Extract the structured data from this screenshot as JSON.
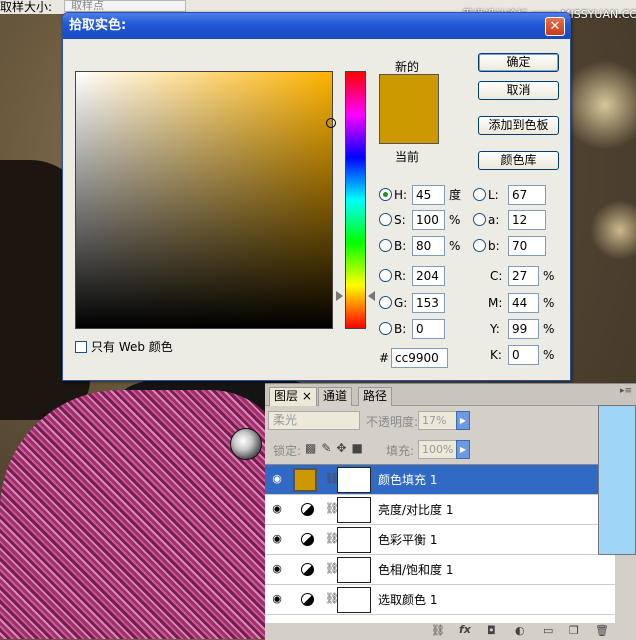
{
  "top": {
    "sample_label": "取样大小:",
    "sample_value": "取样点",
    "site": "思缘设计论坛 www.MISSYUAN.COM"
  },
  "dialog": {
    "title": "拾取实色:",
    "close": "✕",
    "new_label": "新的",
    "current_label": "当前",
    "color_hex": "#cc9900",
    "buttons": {
      "ok": "确定",
      "cancel": "取消",
      "add_swatch": "添加到色板",
      "library": "颜色库"
    },
    "web_only": "只有 Web 颜色",
    "hsb": {
      "h": "45",
      "s": "100",
      "b": "80"
    },
    "rgb": {
      "r": "204",
      "g": "153",
      "b": "0"
    },
    "lab": {
      "l": "67",
      "a": "12",
      "b": "70"
    },
    "cmyk": {
      "c": "27",
      "m": "44",
      "y": "99",
      "k": "0"
    },
    "hex": "cc9900",
    "labels": {
      "h": "H:",
      "s": "S:",
      "bb": "B:",
      "r": "R:",
      "g": "G:",
      "rb": "B:",
      "l": "L:",
      "a": "a:",
      "lb": "b:",
      "c": "C:",
      "m": "M:",
      "y": "Y:",
      "k": "K:",
      "hash": "#"
    },
    "units": {
      "degree": "度",
      "percent": "%"
    },
    "selected_mode": "H"
  },
  "layers_panel": {
    "tabs": [
      "图层",
      "通道",
      "路径"
    ],
    "tab_close": "×",
    "blend_mode": "柔光",
    "opacity_label": "不透明度:",
    "opacity_value": "17%",
    "lock_label": "锁定:",
    "fill_label": "填充:",
    "fill_value": "100%",
    "layers": [
      {
        "name": "颜色填充 1",
        "selected": true,
        "kind": "fill"
      },
      {
        "name": "亮度/对比度 1",
        "selected": false,
        "kind": "adjust"
      },
      {
        "name": "色彩平衡 1",
        "selected": false,
        "kind": "adjust"
      },
      {
        "name": "色相/饱和度 1",
        "selected": false,
        "kind": "adjust"
      },
      {
        "name": "选取颜色 1",
        "selected": false,
        "kind": "adjust"
      }
    ],
    "bottom_icons": [
      "link-icon",
      "fx-icon",
      "mask-icon",
      "adjustment-icon",
      "folder-icon",
      "new-layer-icon",
      "trash-icon"
    ],
    "fx_label": "fx"
  }
}
